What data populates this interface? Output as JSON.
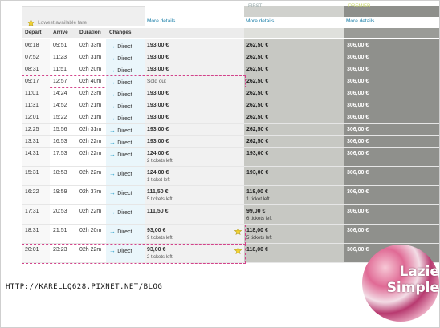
{
  "header": {
    "lowest_fare_label": "Lowest available fare",
    "first_class_tag": "FIRST",
    "premier_tag": "PREMIER",
    "more_details_label": "More details"
  },
  "columns": {
    "depart": "Depart",
    "arrive": "Arrive",
    "duration": "Duration",
    "changes": "Changes"
  },
  "rows": [
    {
      "depart": "06:18",
      "arrive": "09:51",
      "duration": "02h 33m",
      "changes": "Direct",
      "standard": "193,00 €",
      "standard_note": "",
      "first": "262,50 €",
      "first_note": "",
      "premier": "306,00 €"
    },
    {
      "depart": "07:52",
      "arrive": "11:23",
      "duration": "02h 31m",
      "changes": "Direct",
      "standard": "193,00 €",
      "standard_note": "",
      "first": "262,50 €",
      "first_note": "",
      "premier": "306,00 €"
    },
    {
      "depart": "08:31",
      "arrive": "11:51",
      "duration": "02h 20m",
      "changes": "Direct",
      "standard": "193,00 €",
      "standard_note": "",
      "first": "262,50 €",
      "first_note": "",
      "premier": "306,00 €"
    },
    {
      "depart": "09:17",
      "arrive": "12:57",
      "duration": "02h 40m",
      "changes": "Direct",
      "standard": "Sold out",
      "standard_note": "",
      "first": "262,50 €",
      "first_note": "",
      "premier": "306,00 €"
    },
    {
      "depart": "11:01",
      "arrive": "14:24",
      "duration": "02h 23m",
      "changes": "Direct",
      "standard": "193,00 €",
      "standard_note": "",
      "first": "262,50 €",
      "first_note": "",
      "premier": "306,00 €"
    },
    {
      "depart": "11:31",
      "arrive": "14:52",
      "duration": "02h 21m",
      "changes": "Direct",
      "standard": "193,00 €",
      "standard_note": "",
      "first": "262,50 €",
      "first_note": "",
      "premier": "306,00 €"
    },
    {
      "depart": "12:01",
      "arrive": "15:22",
      "duration": "02h 21m",
      "changes": "Direct",
      "standard": "193,00 €",
      "standard_note": "",
      "first": "262,50 €",
      "first_note": "",
      "premier": "306,00 €"
    },
    {
      "depart": "12:25",
      "arrive": "15:56",
      "duration": "02h 31m",
      "changes": "Direct",
      "standard": "193,00 €",
      "standard_note": "",
      "first": "262,50 €",
      "first_note": "",
      "premier": "306,00 €"
    },
    {
      "depart": "13:31",
      "arrive": "16:53",
      "duration": "02h 22m",
      "changes": "Direct",
      "standard": "193,00 €",
      "standard_note": "",
      "first": "262,50 €",
      "first_note": "",
      "premier": "306,00 €"
    },
    {
      "depart": "14:31",
      "arrive": "17:53",
      "duration": "02h 22m",
      "changes": "Direct",
      "standard": "124,00 €",
      "standard_note": "2 tickets left",
      "first": "193,00 €",
      "first_note": "",
      "premier": "306,00 €"
    },
    {
      "depart": "15:31",
      "arrive": "18:53",
      "duration": "02h 22m",
      "changes": "Direct",
      "standard": "124,00 €",
      "standard_note": "1 ticket left",
      "first": "193,00 €",
      "first_note": "",
      "premier": "306,00 €"
    },
    {
      "depart": "16:22",
      "arrive": "19:59",
      "duration": "02h 37m",
      "changes": "Direct",
      "standard": "111,50 €",
      "standard_note": "5 tickets left",
      "first": "118,00 €",
      "first_note": "1 ticket left",
      "premier": "306,00 €"
    },
    {
      "depart": "17:31",
      "arrive": "20:53",
      "duration": "02h 22m",
      "changes": "Direct",
      "standard": "111,50 €",
      "standard_note": "",
      "first": "99,00 €",
      "first_note": "6 tickets left",
      "premier": "306,00 €"
    },
    {
      "depart": "18:31",
      "arrive": "21:51",
      "duration": "02h 20m",
      "changes": "Direct",
      "standard": "93,00 €",
      "standard_note": "9 tickets left",
      "first": "118,00 €",
      "first_note": "5 tickets left",
      "premier": "306,00 €"
    },
    {
      "depart": "20:01",
      "arrive": "23:23",
      "duration": "02h 22m",
      "changes": "Direct",
      "standard": "93,00 €",
      "standard_note": "2 tickets left",
      "first": "118,00 €",
      "first_note": "",
      "premier": "306,00 €"
    }
  ],
  "footer": {
    "blog_url": "HTTP://KARELLQ628.PIXNET.NET/BLOG",
    "logo_line1": "Lazie",
    "logo_line2": "Simple"
  },
  "colors": {
    "accent_link": "#1b7fa8",
    "first_col": "#c7c8c3",
    "premier_col": "#8f908c",
    "highlight_dash": "#d2438a",
    "star": "#f2d230"
  }
}
